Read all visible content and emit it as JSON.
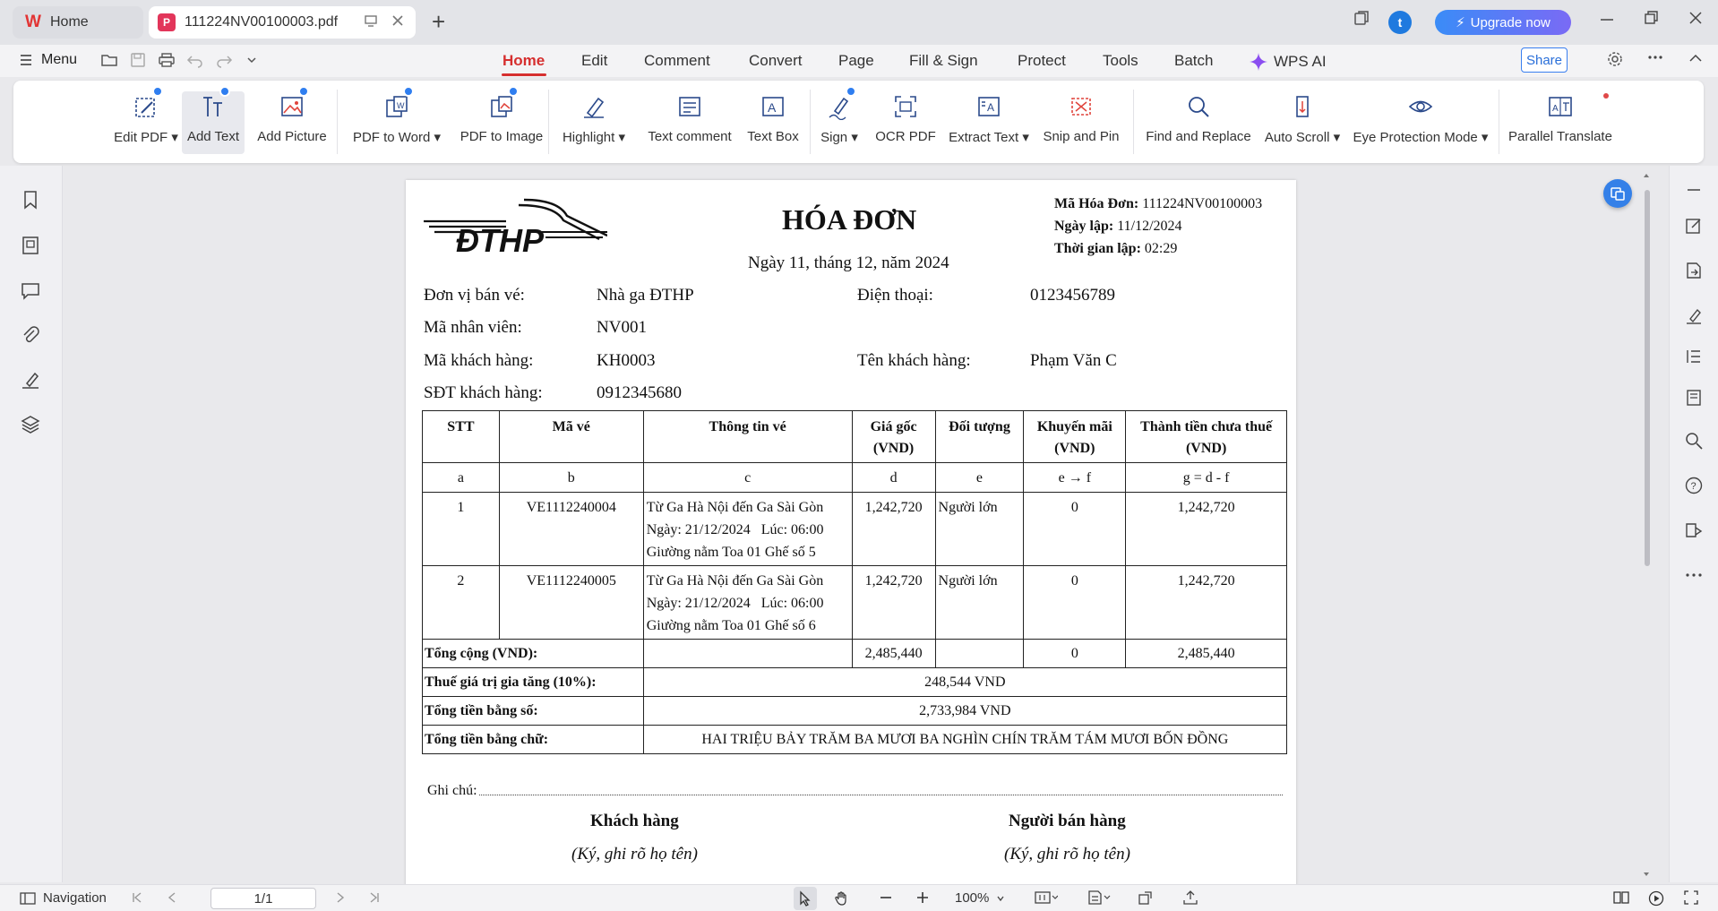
{
  "titlebar": {
    "home_tab": "Home",
    "doc_tab": "111224NV00100003.pdf",
    "avatar_letter": "t",
    "upgrade_label": "Upgrade now"
  },
  "menubar": {
    "menu_label": "Menu",
    "tabs": [
      "Home",
      "Edit",
      "Comment",
      "Convert",
      "Page",
      "Fill & Sign",
      "Protect",
      "Tools",
      "Batch",
      "WPS AI"
    ],
    "active_tab": "Home",
    "share_label": "Share"
  },
  "ribbon": {
    "items": [
      "Edit PDF",
      "Add Text",
      "Add Picture",
      "PDF to Word",
      "PDF to Image",
      "Highlight",
      "Text comment",
      "Text Box",
      "Sign",
      "OCR PDF",
      "Extract Text",
      "Snip and Pin",
      "Find and Replace",
      "Auto Scroll",
      "Eye Protection Mode",
      "Parallel Translate"
    ],
    "selected": "Add Text"
  },
  "document": {
    "title": "HÓA ĐƠN",
    "date_line": "Ngày 11, tháng 12, năm 2024",
    "logo_text": "ĐTHP",
    "meta": [
      {
        "label": "Mã Hóa Đơn:",
        "value": "111224NV00100003"
      },
      {
        "label": "Ngày lập:",
        "value": "11/12/2024"
      },
      {
        "label": "Thời gian lập:",
        "value": "02:29"
      }
    ],
    "info": {
      "seller_label": "Đơn vị bán vé:",
      "seller_value": "Nhà ga ĐTHP",
      "phone_label": "Điện thoại:",
      "phone_value": "0123456789",
      "staff_label": "Mã nhân viên:",
      "staff_value": "NV001",
      "customer_id_label": "Mã khách hàng:",
      "customer_id_value": "KH0003",
      "customer_name_label": "Tên khách hàng:",
      "customer_name_value": "Phạm Văn C",
      "customer_phone_label": "SĐT khách hàng:",
      "customer_phone_value": "0912345680"
    },
    "table": {
      "headers": [
        "STT",
        "Mã vé",
        "Thông tin vé",
        "Giá gốc\n(VND)",
        "Đối tượng",
        "Khuyến mãi\n(VND)",
        "Thành tiền chưa thuế\n(VND)"
      ],
      "codes": [
        "a",
        "b",
        "c",
        "d",
        "e",
        "e → f",
        "g = d - f"
      ],
      "rows": [
        {
          "stt": "1",
          "ma_ve": "VE1112240004",
          "info1": "Từ Ga Hà Nội đến Ga Sài Gòn",
          "info2": "Ngày: 21/12/2024   Lúc: 06:00",
          "info3": "Giường nằm Toa 01 Ghế số 5",
          "gia_goc": "1,242,720",
          "doi_tuong": "Người lớn",
          "khuyen_mai": "0",
          "thanh_tien": "1,242,720"
        },
        {
          "stt": "2",
          "ma_ve": "VE1112240005",
          "info1": "Từ Ga Hà Nội đến Ga Sài Gòn",
          "info2": "Ngày: 21/12/2024   Lúc: 06:00",
          "info3": "Giường nằm Toa 01 Ghế số 6",
          "gia_goc": "1,242,720",
          "doi_tuong": "Người lớn",
          "khuyen_mai": "0",
          "thanh_tien": "1,242,720"
        }
      ],
      "total_label": "Tổng cộng (VND):",
      "total_gia_goc": "2,485,440",
      "total_khuyen_mai": "0",
      "total_thanh_tien": "2,485,440",
      "vat_label": "Thuế giá trị gia tăng (10%):",
      "vat_value": "248,544 VND",
      "sum_num_label": "Tổng tiền bằng số:",
      "sum_num_value": "2,733,984 VND",
      "sum_text_label": "Tổng tiền bằng chữ:",
      "sum_text_value": "HAI TRIỆU BẢY TRĂM BA MƯƠI BA NGHÌN CHÍN TRĂM TÁM MƯƠI BỐN ĐỒNG"
    },
    "note_label": "Ghi chú:",
    "sign_customer": "Khách hàng",
    "sign_customer_sub": "(Ký, ghi rõ họ tên)",
    "sign_seller": "Người bán hàng",
    "sign_seller_sub": "(Ký, ghi rõ họ tên)"
  },
  "statusbar": {
    "navigation_label": "Navigation",
    "page_indicator": "1/1",
    "zoom": "100%"
  },
  "colors": {
    "accent_red": "#d62f2f",
    "brand_blue": "#3a7ff0"
  }
}
